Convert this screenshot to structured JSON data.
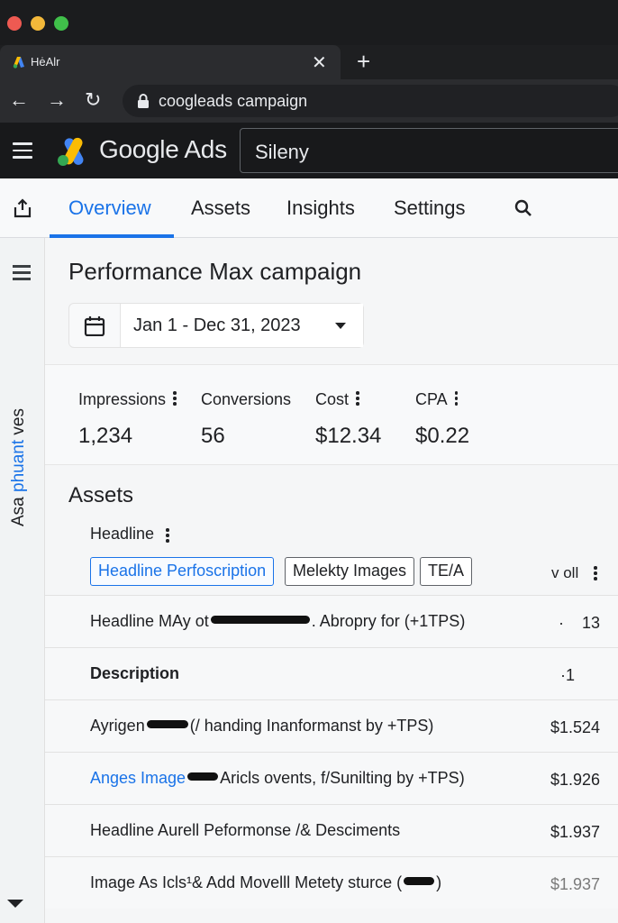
{
  "browser": {
    "tab_title": "HėAlr",
    "url": "coogleads campaign"
  },
  "appbar": {
    "product_name": "Google Ads",
    "account_name": "Sileny"
  },
  "tabs": [
    {
      "label": "Overview",
      "active": true
    },
    {
      "label": "Assets",
      "active": false
    },
    {
      "label": "Insights",
      "active": false
    },
    {
      "label": "Settings",
      "active": false
    }
  ],
  "rail": {
    "label_start": "Asa ",
    "label_link": "phuant",
    "label_end": " ves"
  },
  "campaign": {
    "title": "Performance Max campaign",
    "date_range": "Jan 1 - Dec 31, 2023"
  },
  "metrics": [
    {
      "label": "Impressions",
      "value": "1,234"
    },
    {
      "label": "Conversions",
      "value": "56"
    },
    {
      "label": "Cost",
      "value": "$12.34"
    },
    {
      "label": "CPA",
      "value": "$0.22"
    }
  ],
  "assets": {
    "title": "Assets",
    "headline_header": "Headline",
    "chips": [
      "Headline Perfoscription",
      "Melekty Images",
      "TE/A"
    ],
    "chip_end_label": "v oll",
    "rows": [
      {
        "text_a": "Headline MAy ot",
        "text_b": ". Abropry for (+1TPS)",
        "value": "13",
        "prefix": "·"
      },
      {
        "text_a": "Description",
        "text_b": "",
        "value": "1",
        "prefix": "·"
      },
      {
        "text_a": "Ayrigen",
        "text_b": "(/ handing Inanformanst by +TPS)",
        "value": "$1.524",
        "prefix": ""
      },
      {
        "text_a": "Anges Image",
        "text_b": "Aricls ovents, f/Sunilting by +TPS)",
        "value": "$1.926",
        "prefix": ""
      },
      {
        "text_a": "Headline Aurell Peformonse /& Desciments",
        "text_b": "",
        "value": "$1.937",
        "prefix": ""
      },
      {
        "text_a": "Image As Icls¹& Add Movelll Metety sturce (",
        "text_b": ")",
        "value": "$1.937",
        "prefix": ""
      }
    ]
  },
  "colors": {
    "accent": "#1a73e8",
    "chrome_dark": "#1e1f21",
    "logo_blue": "#4285f4",
    "logo_yellow": "#fbbc04",
    "logo_green": "#34a853"
  }
}
